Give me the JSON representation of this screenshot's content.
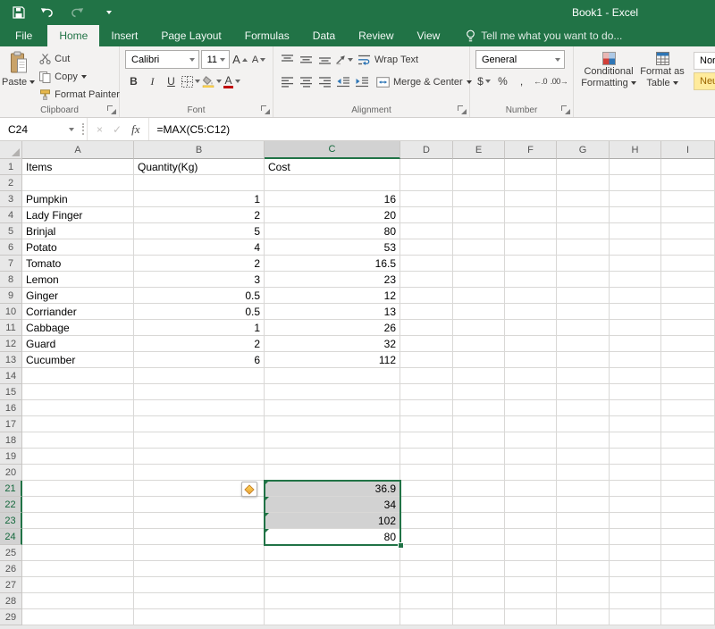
{
  "title_bar": {
    "title": "Book1 - Excel"
  },
  "ribbon_tabs": {
    "file": "File",
    "tabs": [
      "Home",
      "Insert",
      "Page Layout",
      "Formulas",
      "Data",
      "Review",
      "View"
    ],
    "active": "Home",
    "tell_me": "Tell me what you want to do..."
  },
  "ribbon": {
    "clipboard": {
      "group": "Clipboard",
      "paste": "Paste",
      "cut": "Cut",
      "copy": "Copy",
      "format_painter": "Format Painter"
    },
    "font": {
      "group": "Font",
      "name": "Calibri",
      "size": "11",
      "bold": "B",
      "italic": "I",
      "underline": "U",
      "grow": "A",
      "shrink": "A",
      "font_color": "A"
    },
    "alignment": {
      "group": "Alignment",
      "wrap_text": "Wrap Text",
      "merge_center": "Merge & Center"
    },
    "number": {
      "group": "Number",
      "format": "General",
      "accounting": "$",
      "percent": "%",
      "comma": ",",
      "increase_decimal": "←.0",
      "decrease_decimal": ".00→"
    },
    "styles": {
      "conditional_line1": "Conditional",
      "conditional_line2": "Formatting",
      "format_table_line1": "Format as",
      "format_table_line2": "Table",
      "cell_styles": [
        {
          "label": "Normal",
          "type": "normal"
        },
        {
          "label": "Neutral",
          "type": "neutral"
        }
      ]
    }
  },
  "formula_bar": {
    "name_box": "C24",
    "cancel": "×",
    "enter": "✓",
    "fx": "fx",
    "formula": "=MAX(C5:C12)"
  },
  "sheet": {
    "columns": [
      "A",
      "B",
      "C",
      "D",
      "E",
      "F",
      "G",
      "H",
      "I"
    ],
    "row_count": 29,
    "cells": [
      {
        "ref": "A1",
        "v": "Items",
        "align": "left"
      },
      {
        "ref": "B1",
        "v": "Quantity(Kg)",
        "align": "left"
      },
      {
        "ref": "C1",
        "v": "Cost",
        "align": "left"
      },
      {
        "ref": "A3",
        "v": "Pumpkin",
        "align": "left"
      },
      {
        "ref": "B3",
        "v": "1",
        "align": "right"
      },
      {
        "ref": "C3",
        "v": "16",
        "align": "right"
      },
      {
        "ref": "A4",
        "v": "Lady Finger",
        "align": "left"
      },
      {
        "ref": "B4",
        "v": "2",
        "align": "right"
      },
      {
        "ref": "C4",
        "v": "20",
        "align": "right"
      },
      {
        "ref": "A5",
        "v": "Brinjal",
        "align": "left"
      },
      {
        "ref": "B5",
        "v": "5",
        "align": "right"
      },
      {
        "ref": "C5",
        "v": "80",
        "align": "right"
      },
      {
        "ref": "A6",
        "v": "Potato",
        "align": "left"
      },
      {
        "ref": "B6",
        "v": "4",
        "align": "right"
      },
      {
        "ref": "C6",
        "v": "53",
        "align": "right"
      },
      {
        "ref": "A7",
        "v": "Tomato",
        "align": "left"
      },
      {
        "ref": "B7",
        "v": "2",
        "align": "right"
      },
      {
        "ref": "C7",
        "v": "16.5",
        "align": "right"
      },
      {
        "ref": "A8",
        "v": "Lemon",
        "align": "left"
      },
      {
        "ref": "B8",
        "v": "3",
        "align": "right"
      },
      {
        "ref": "C8",
        "v": "23",
        "align": "right"
      },
      {
        "ref": "A9",
        "v": "Ginger",
        "align": "left"
      },
      {
        "ref": "B9",
        "v": "0.5",
        "align": "right"
      },
      {
        "ref": "C9",
        "v": "12",
        "align": "right"
      },
      {
        "ref": "A10",
        "v": "Corriander",
        "align": "left"
      },
      {
        "ref": "B10",
        "v": "0.5",
        "align": "right"
      },
      {
        "ref": "C10",
        "v": "13",
        "align": "right"
      },
      {
        "ref": "A11",
        "v": "Cabbage",
        "align": "left"
      },
      {
        "ref": "B11",
        "v": "1",
        "align": "right"
      },
      {
        "ref": "C11",
        "v": "26",
        "align": "right"
      },
      {
        "ref": "A12",
        "v": "Guard",
        "align": "left"
      },
      {
        "ref": "B12",
        "v": "2",
        "align": "right"
      },
      {
        "ref": "C12",
        "v": "32",
        "align": "right"
      },
      {
        "ref": "A13",
        "v": "Cucumber",
        "align": "left"
      },
      {
        "ref": "B13",
        "v": "6",
        "align": "right"
      },
      {
        "ref": "C13",
        "v": "112",
        "align": "right"
      },
      {
        "ref": "C21",
        "v": "36.9",
        "align": "right"
      },
      {
        "ref": "C22",
        "v": "34",
        "align": "right"
      },
      {
        "ref": "C23",
        "v": "102",
        "align": "right"
      },
      {
        "ref": "C24",
        "v": "80",
        "align": "right"
      }
    ],
    "selection": {
      "range": "C21:C24",
      "active_cell": "C24",
      "column": "C",
      "rows": [
        21,
        22,
        23,
        24
      ],
      "fill_cells": [
        "C21",
        "C22",
        "C23"
      ],
      "error_cells": [
        "C21",
        "C22",
        "C23",
        "C24"
      ]
    }
  }
}
